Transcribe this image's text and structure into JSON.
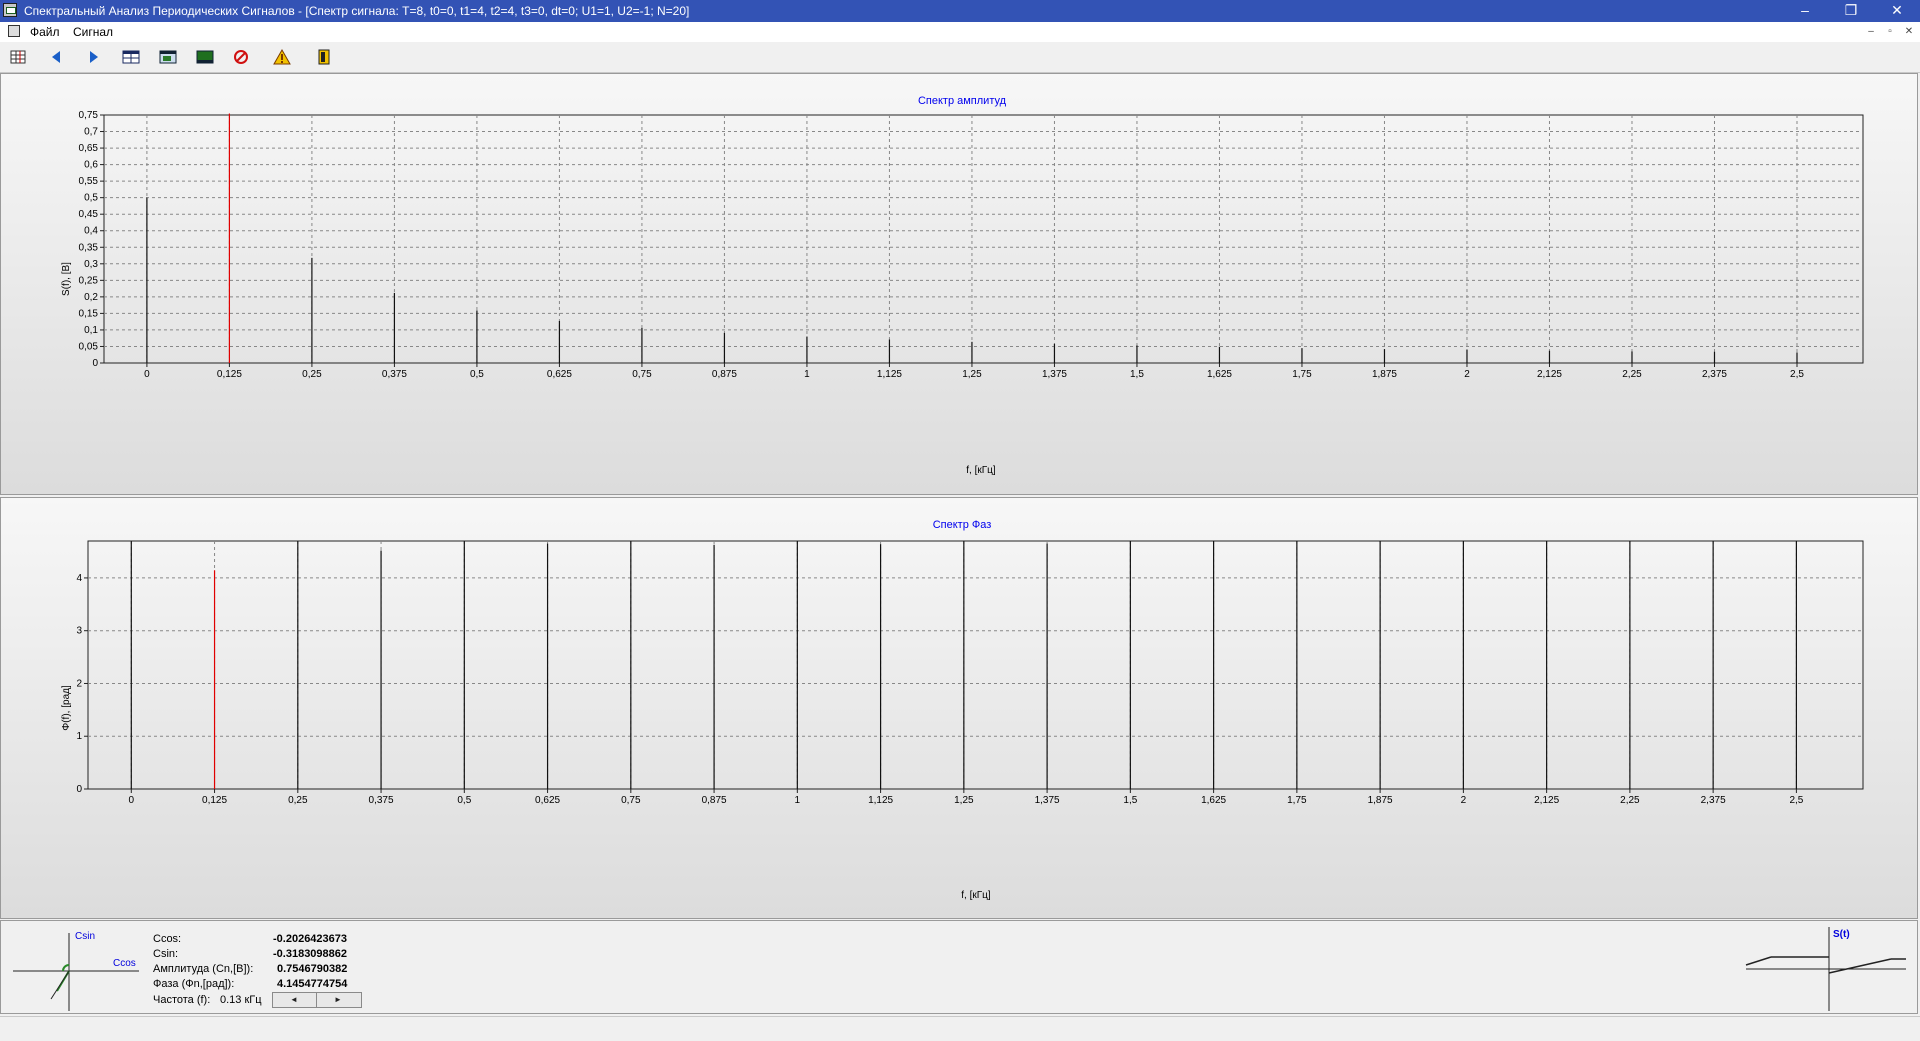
{
  "window": {
    "title": "Спектральный Анализ Периодических Сигналов - [Спектр сигнала: T=8, t0=0, t1=4, t2=4, t3=0, dt=0; U1=1, U2=-1; N=20]",
    "minimize": "–",
    "maximize": "❐",
    "close": "✕"
  },
  "menu": {
    "file": "Файл",
    "signal": "Сигнал"
  },
  "toolbar": {
    "icons": [
      "table-grid-icon",
      "arrow-left-icon",
      "arrow-right-icon",
      "table-icon",
      "window-icon",
      "screen-icon",
      "stop-icon",
      "warning-icon",
      "exit-door-icon"
    ]
  },
  "colors": {
    "titlebar": "#3353b5",
    "chart_title": "#0000ee",
    "marker": "#e00000"
  },
  "chart_data": [
    {
      "type": "bar",
      "title": "Спектр амплитуд",
      "xlabel": "f, [кГц]",
      "ylabel": "S(f), [В]",
      "xlim": [
        -0.065,
        2.6
      ],
      "ylim": [
        0,
        0.75
      ],
      "x_ticks": [
        "0",
        "0,125",
        "0,25",
        "0,375",
        "0,5",
        "0,625",
        "0,75",
        "0,875",
        "1",
        "1,125",
        "1,25",
        "1,375",
        "1,5",
        "1,625",
        "1,75",
        "1,875",
        "2",
        "2,125",
        "2,25",
        "2,375",
        "2,5"
      ],
      "y_ticks": [
        "0",
        "0,05",
        "0,1",
        "0,15",
        "0,2",
        "0,25",
        "0,3",
        "0,35",
        "0,4",
        "0,45",
        "0,5",
        "0,55",
        "0,6",
        "0,65",
        "0,7",
        "0,75"
      ],
      "grid": true,
      "x": [
        0,
        0.25,
        0.375,
        0.5,
        0.625,
        0.75,
        0.875,
        1.0,
        1.125,
        1.25,
        1.375,
        1.5,
        1.625,
        1.75,
        1.875,
        2.0,
        2.125,
        2.25,
        2.375,
        2.5
      ],
      "values": [
        0.5,
        0.318,
        0.212,
        0.159,
        0.127,
        0.106,
        0.091,
        0.08,
        0.071,
        0.064,
        0.058,
        0.053,
        0.049,
        0.045,
        0.042,
        0.04,
        0.037,
        0.035,
        0.034,
        0.032
      ],
      "marker": {
        "x": 0.125,
        "value": 0.7547
      }
    },
    {
      "type": "bar",
      "title": "Спектр Фаз",
      "xlabel": "f, [кГц]",
      "ylabel": "Φ(f), [рад]",
      "xlim": [
        -0.065,
        2.6
      ],
      "ylim": [
        0,
        4.7
      ],
      "x_ticks": [
        "0",
        "0,125",
        "0,25",
        "0,375",
        "0,5",
        "0,625",
        "0,75",
        "0,875",
        "1",
        "1,125",
        "1,25",
        "1,375",
        "1,5",
        "1,625",
        "1,75",
        "1,875",
        "2",
        "2,125",
        "2,25",
        "2,375",
        "2,5"
      ],
      "y_ticks": [
        "0",
        "1",
        "2",
        "3",
        "4"
      ],
      "grid": true,
      "x": [
        0,
        0.25,
        0.375,
        0.5,
        0.625,
        0.75,
        0.875,
        1.0,
        1.125,
        1.25,
        1.375,
        1.5,
        1.625,
        1.75,
        1.875,
        2.0,
        2.125,
        2.25,
        2.375,
        2.5
      ],
      "values": [
        4.7,
        4.7,
        4.52,
        4.7,
        4.65,
        4.7,
        4.63,
        4.7,
        4.64,
        4.7,
        4.65,
        4.7,
        4.7,
        4.7,
        4.7,
        4.7,
        4.7,
        4.7,
        4.7,
        4.7
      ],
      "marker": {
        "x": 0.125,
        "value": 4.1455
      }
    }
  ],
  "info": {
    "ccos_label": "Ccos:",
    "ccos_value": "-0.2026423673",
    "csin_label": "Csin:",
    "csin_value": "-0.3183098862",
    "amp_label": "Амплитуда (Cn,[В]):",
    "amp_value": "0.7546790382",
    "phase_label": "Фаза (Фn,[рад]):",
    "phase_value": "4.1454774754",
    "freq_label": "Частота (f):",
    "freq_value": "0.13 кГц"
  },
  "vector_diagram": {
    "csin_label": "Csin",
    "ccos_label": "Ccos"
  },
  "signal_preview": {
    "label": "S(t)"
  }
}
